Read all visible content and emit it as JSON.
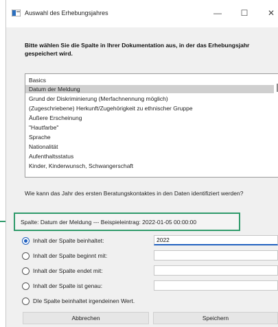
{
  "window": {
    "title": "Auswahl des Erhebungsjahres",
    "controls": {
      "minimize": "—",
      "maximize": "☐",
      "close": "✕"
    }
  },
  "instruction": "Bitte wählen Sie die Spalte in Ihrer Dokumentation aus, in der das Erhebungsjahr gespeichert wird.",
  "columns_list": {
    "items": [
      "Basics",
      "Datum der Meldung",
      "Grund der Diskriminierung (Merfachnennung möglich)",
      "(Zugeschriebene) Herkunft/Zugehörigkeit zu ethnischer Gruppe",
      "Äußere Erscheinung",
      "\"Hautfarbe\"",
      "Sprache",
      "Nationalität",
      "Aufenthaltsstatus",
      "Kinder, Kinderwunsch, Schwangerschaft"
    ],
    "selected": "Datum der Meldung"
  },
  "question": "Wie kann das Jahr des ersten Beratungskontaktes in den Daten identifiziert werden?",
  "column_info": "Spalte: Datum der Meldung --- Beispieleintrag: 2022-01-05 00:00:00",
  "options": [
    {
      "label": "Inhalt der Spalte beinhaltet:",
      "value": "2022",
      "checked": true
    },
    {
      "label": "Inhalt der Spalte beginnt mit:",
      "value": "",
      "checked": false
    },
    {
      "label": "Inhalt der Spalte endet mit:",
      "value": "",
      "checked": false
    },
    {
      "label": "Inhalt der Spalte ist genau:",
      "value": "",
      "checked": false
    },
    {
      "label": "DIe Spalte beinhaltet irgendeinen Wert.",
      "checked": false
    }
  ],
  "buttons": {
    "cancel": "Abbrechen",
    "save": "Speichern"
  },
  "colors": {
    "accent": "#1f5fbf",
    "highlight_border": "#2e9a6a",
    "selection": "#cfcfcf"
  }
}
